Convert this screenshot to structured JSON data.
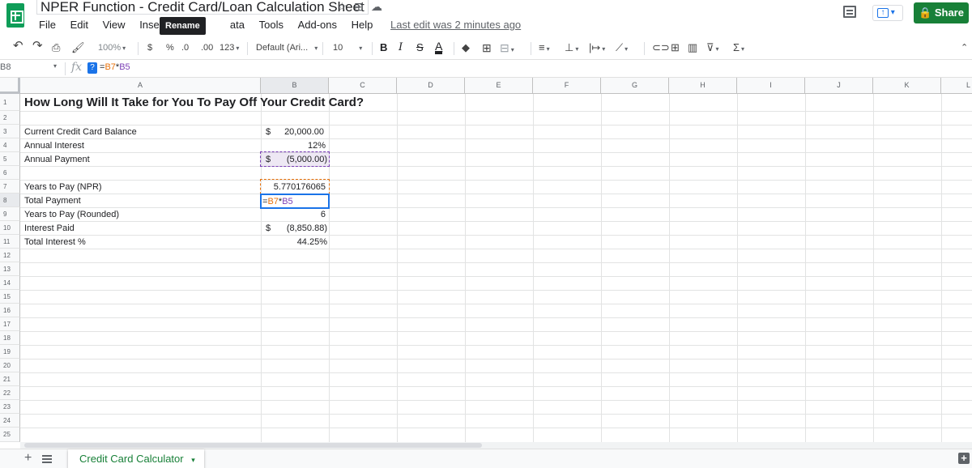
{
  "app": {
    "title": "NPER Function - Credit Card/Loan Calculation Sheet",
    "share_label": "Share",
    "rename_tooltip": "Rename",
    "last_edit": "Last edit was 2 minutes ago",
    "accent_color": "#188038"
  },
  "menu": {
    "file": "File",
    "edit": "Edit",
    "view": "View",
    "insert": "Insert",
    "format": "F",
    "data": "ata",
    "tools": "Tools",
    "addons": "Add-ons",
    "help": "Help"
  },
  "toolbar": {
    "zoom": "100%",
    "currency": "$",
    "percent": "%",
    "dec_decrease": ".0",
    "dec_increase": ".00",
    "more_formats": "123",
    "font": "Default (Ari...",
    "font_size": "10",
    "bold": "B",
    "italic": "I",
    "strike": "S",
    "text_color": "A",
    "function_sigma": "Σ"
  },
  "formula_bar": {
    "name_box": "B8",
    "fx": "fx",
    "help_mark": "?",
    "formula_prefix": "=",
    "formula_ref1": "B7",
    "formula_op": "*",
    "formula_ref2": "B5"
  },
  "grid": {
    "columns": [
      "A",
      "B",
      "C",
      "D",
      "E",
      "F",
      "G",
      "H",
      "I",
      "J",
      "K",
      "L"
    ],
    "rows": [
      "1",
      "2",
      "3",
      "4",
      "5",
      "6",
      "7",
      "8",
      "9",
      "10",
      "11",
      "12",
      "13",
      "14",
      "15",
      "16",
      "17",
      "18",
      "19",
      "20",
      "21",
      "22",
      "23",
      "24",
      "25"
    ],
    "cells": {
      "A1": "How Long Will It Take for You To Pay Off Your Credit Card?",
      "A3": "Current Credit Card Balance",
      "A4": "Annual Interest",
      "A5": "Annual Payment",
      "A7": "Years to Pay (NPR)",
      "A8": "Total Payment",
      "A9": "Years to Pay (Rounded)",
      "A10": "Interest Paid",
      "A11": "Total Interest %",
      "B3_symbol": "$",
      "B3": "20,000.00",
      "B4": "12%",
      "B5_symbol": "$",
      "B5": "(5,000.00)",
      "B7": "5.770176065",
      "B8_editing": "=B7*B5",
      "B9": "6",
      "B10_symbol": "$",
      "B10": "(8,850.88)",
      "B11": "44.25%"
    }
  },
  "sheets": {
    "active_tab": "Credit Card Calculator",
    "add_label": "+"
  }
}
